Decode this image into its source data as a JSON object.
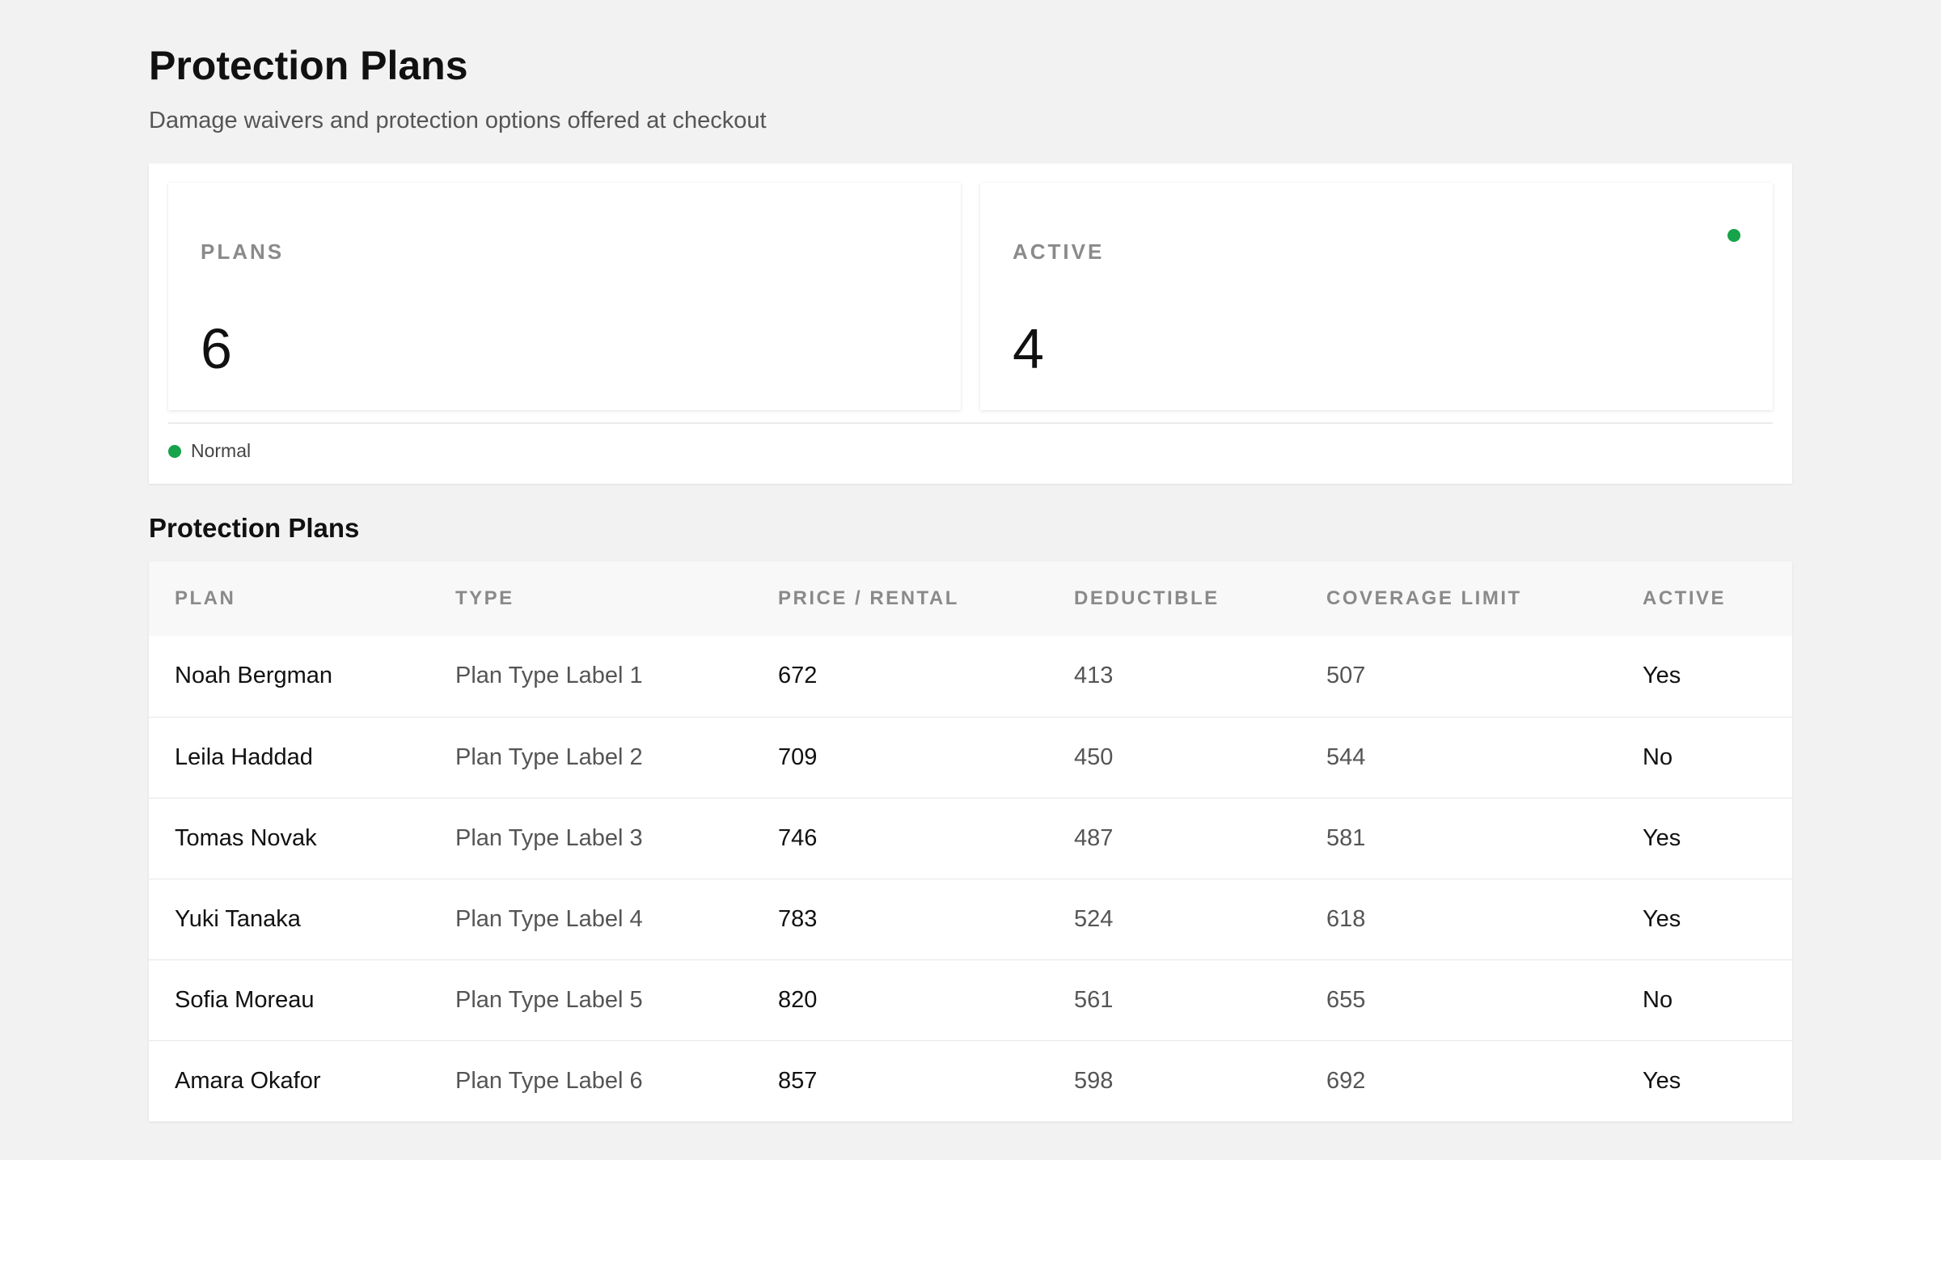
{
  "header": {
    "title": "Protection Plans",
    "subtitle": "Damage waivers and protection options offered at checkout"
  },
  "summary": {
    "cards": [
      {
        "label": "PLANS",
        "value": "6"
      },
      {
        "label": "ACTIVE",
        "value": "4",
        "indicator_color": "#16a34a"
      }
    ],
    "legend": {
      "label": "Normal",
      "color": "#16a34a"
    }
  },
  "table": {
    "section_title": "Protection Plans",
    "columns": [
      "PLAN",
      "TYPE",
      "PRICE / RENTAL",
      "DEDUCTIBLE",
      "COVERAGE LIMIT",
      "ACTIVE"
    ],
    "rows": [
      {
        "plan": "Noah Bergman",
        "type": "Plan Type Label 1",
        "price": "672",
        "deductible": "413",
        "coverage": "507",
        "active": "Yes"
      },
      {
        "plan": "Leila Haddad",
        "type": "Plan Type Label 2",
        "price": "709",
        "deductible": "450",
        "coverage": "544",
        "active": "No"
      },
      {
        "plan": "Tomas Novak",
        "type": "Plan Type Label 3",
        "price": "746",
        "deductible": "487",
        "coverage": "581",
        "active": "Yes"
      },
      {
        "plan": "Yuki Tanaka",
        "type": "Plan Type Label 4",
        "price": "783",
        "deductible": "524",
        "coverage": "618",
        "active": "Yes"
      },
      {
        "plan": "Sofia Moreau",
        "type": "Plan Type Label 5",
        "price": "820",
        "deductible": "561",
        "coverage": "655",
        "active": "No"
      },
      {
        "plan": "Amara Okafor",
        "type": "Plan Type Label 6",
        "price": "857",
        "deductible": "598",
        "coverage": "692",
        "active": "Yes"
      }
    ]
  },
  "colors": {
    "status_green": "#16a34a",
    "page_background": "#f2f2f2"
  }
}
